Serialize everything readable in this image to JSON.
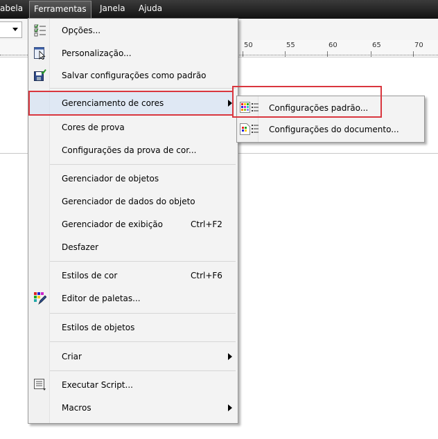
{
  "menubar": {
    "items": [
      {
        "label": "abela"
      },
      {
        "label": "Ferramentas"
      },
      {
        "label": "Janela"
      },
      {
        "label": "Ajuda"
      }
    ]
  },
  "ruler": {
    "ticks": [
      "50",
      "55",
      "60",
      "65",
      "70"
    ]
  },
  "menu": {
    "opcoes": "Opções...",
    "personalizacao": "Personalização...",
    "salvar": "Salvar configurações como padrão",
    "gerenciamento": "Gerenciamento de cores",
    "cores_prova": "Cores de prova",
    "config_prova": "Configurações da prova de cor...",
    "gerenciador_objetos": "Gerenciador de objetos",
    "gerenciador_dados": "Gerenciador de dados do objeto",
    "gerenciador_exibicao": "Gerenciador de exibição",
    "gerenciador_exibicao_sc": "Ctrl+F2",
    "desfazer": "Desfazer",
    "estilos_cor": "Estilos de cor",
    "estilos_cor_sc": "Ctrl+F6",
    "editor_paletas": "Editor de paletas...",
    "estilos_objetos": "Estilos de objetos",
    "criar": "Criar",
    "executar_script": "Executar Script...",
    "macros": "Macros"
  },
  "submenu": {
    "config_padrao": "Configurações padrão...",
    "config_documento": "Configurações do documento..."
  },
  "colors": {
    "highlight_border": "#d9363e",
    "menubar_bg": "#1e1e1e"
  }
}
